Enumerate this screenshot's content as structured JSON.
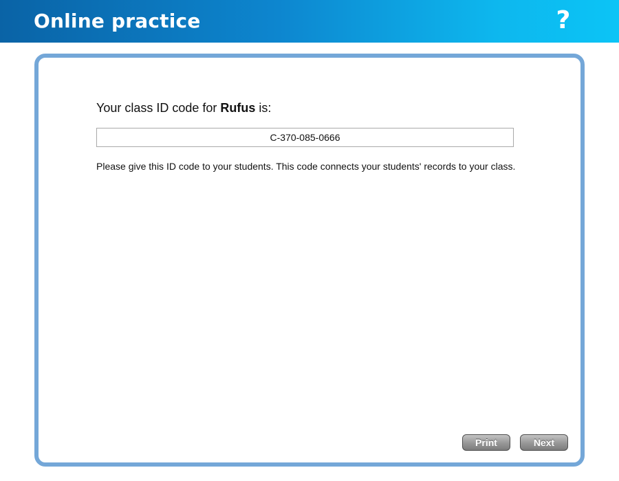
{
  "header": {
    "title": "Online practice",
    "help_icon": "?"
  },
  "main": {
    "prompt_prefix": "Your class ID code for ",
    "class_name": "Rufus",
    "prompt_suffix": " is:",
    "class_id_code": "C-370-085-0666",
    "info_text": "Please give this ID code to your students. This code connects your students' records to your class."
  },
  "footer": {
    "print_label": "Print",
    "next_label": "Next"
  },
  "colors": {
    "header_gradient_start": "#0a63a6",
    "header_gradient_end": "#0cc4f6",
    "panel_border": "#74a7d8",
    "button_gray": "#8f8f8f"
  }
}
